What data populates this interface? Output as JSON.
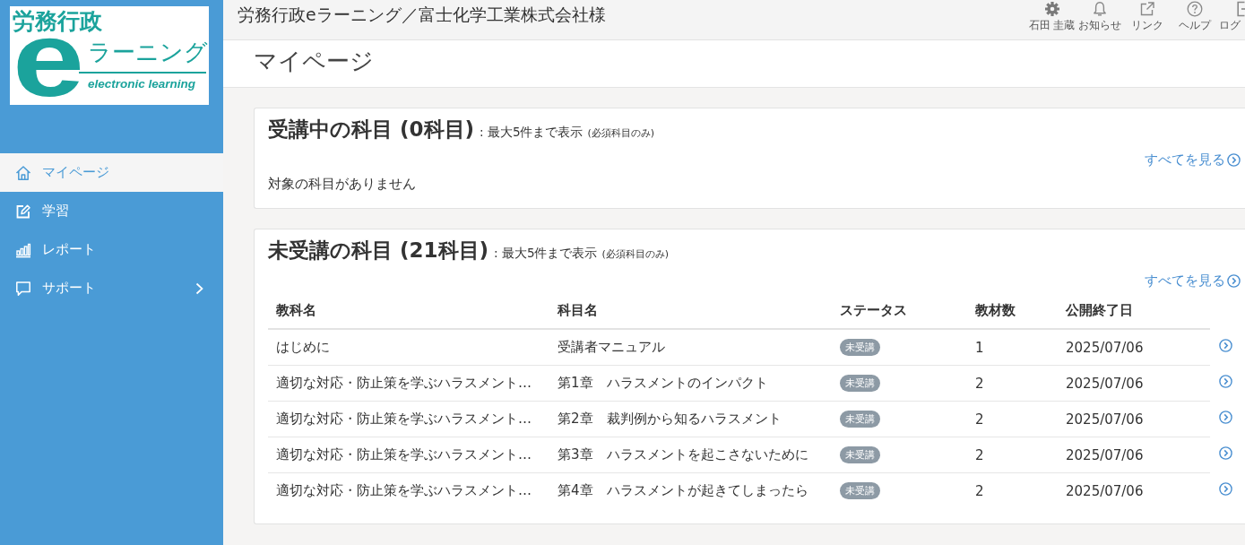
{
  "sidebar": {
    "logo": {
      "line_1": "労務行政",
      "letter": "e",
      "line_2": "ラーニング",
      "tagline": "electronic learning"
    },
    "items": [
      {
        "label": "マイページ",
        "selected": true,
        "has_submenu": false
      },
      {
        "label": "学習",
        "selected": false,
        "has_submenu": false
      },
      {
        "label": "レポート",
        "selected": false,
        "has_submenu": false
      },
      {
        "label": "サポート",
        "selected": false,
        "has_submenu": true
      }
    ]
  },
  "header": {
    "title": "労務行政eラーニング／富士化学工業株式会社様",
    "actions": [
      {
        "label": "石田 圭蔵"
      },
      {
        "label": "お知らせ"
      },
      {
        "label": "リンク"
      },
      {
        "label": "ヘルプ"
      },
      {
        "label": "ログ"
      }
    ]
  },
  "page_title": "マイページ",
  "sections": [
    {
      "title": "受講中の科目 (0科目)",
      "note": ": 最大5件まで表示",
      "sub_note": "(必須科目のみ)",
      "link": "すべてを見る",
      "empty_message": "対象の科目がありません"
    },
    {
      "title": "未受講の科目 (21科目)",
      "note": ": 最大5件まで表示",
      "sub_note": "(必須科目のみ)",
      "link": "すべてを見る",
      "table": {
        "columns": [
          "教科名",
          "科目名",
          "ステータス",
          "教材数",
          "公開終了日"
        ],
        "rows": [
          {
            "cells": [
              "はじめに",
              "受講者マニュアル",
              "未受講",
              "1",
              "2025/07/06"
            ]
          },
          {
            "cells": [
              "適切な対応・防止策を学ぶハラスメント…",
              "第1章　ハラスメントのインパクト",
              "未受講",
              "2",
              "2025/07/06"
            ]
          },
          {
            "cells": [
              "適切な対応・防止策を学ぶハラスメント…",
              "第2章　裁判例から知るハラスメント",
              "未受講",
              "2",
              "2025/07/06"
            ]
          },
          {
            "cells": [
              "適切な対応・防止策を学ぶハラスメント…",
              "第3章　ハラスメントを起こさないために",
              "未受講",
              "2",
              "2025/07/06"
            ]
          },
          {
            "cells": [
              "適切な対応・防止策を学ぶハラスメント…",
              "第4章　ハラスメントが起きてしまったら",
              "未受講",
              "2",
              "2025/07/06"
            ]
          }
        ]
      }
    }
  ]
}
